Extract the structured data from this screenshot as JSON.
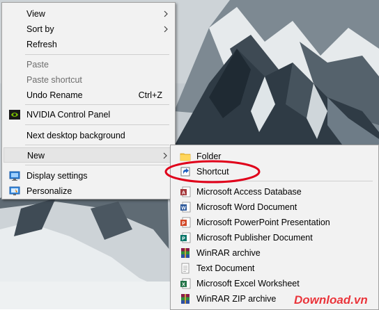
{
  "context_menu": {
    "items": [
      {
        "label": "View"
      },
      {
        "label": "Sort by"
      },
      {
        "label": "Refresh"
      },
      {
        "label": "Paste"
      },
      {
        "label": "Paste shortcut"
      },
      {
        "label": "Undo Rename",
        "shortcut": "Ctrl+Z"
      },
      {
        "label": "NVIDIA Control Panel",
        "icon": "nvidia-icon"
      },
      {
        "label": "Next desktop background"
      },
      {
        "label": "New"
      },
      {
        "label": "Display settings",
        "icon": "display-settings-icon"
      },
      {
        "label": "Personalize",
        "icon": "personalize-icon"
      }
    ]
  },
  "new_submenu": {
    "items": [
      {
        "label": "Folder",
        "icon": "folder-icon"
      },
      {
        "label": "Shortcut",
        "icon": "shortcut-icon"
      },
      {
        "label": "Microsoft Access Database",
        "icon": "access-icon"
      },
      {
        "label": "Microsoft Word Document",
        "icon": "word-icon"
      },
      {
        "label": "Microsoft PowerPoint Presentation",
        "icon": "powerpoint-icon"
      },
      {
        "label": "Microsoft Publisher Document",
        "icon": "publisher-icon"
      },
      {
        "label": "WinRAR archive",
        "icon": "winrar-icon"
      },
      {
        "label": "Text Document",
        "icon": "text-document-icon"
      },
      {
        "label": "Microsoft Excel Worksheet",
        "icon": "excel-icon"
      },
      {
        "label": "WinRAR ZIP archive",
        "icon": "winrar-zip-icon"
      }
    ]
  },
  "watermark": {
    "text": "Download.vn"
  },
  "colors": {
    "menu_bg": "#f2f2f2",
    "highlight_oval": "#e0001a",
    "watermark": "#e8343a"
  }
}
